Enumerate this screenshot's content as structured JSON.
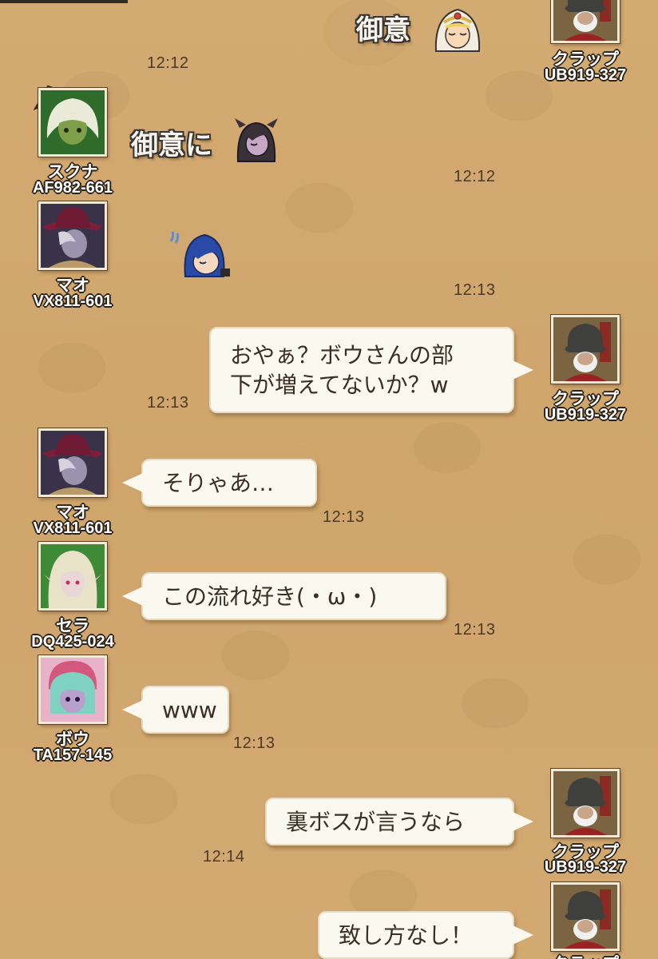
{
  "colors": {
    "background": "#d1a76f",
    "bubble": "#fbf8ef",
    "bubble_text": "#3a2f24",
    "name_outline": "#2b2218",
    "timestamp": "#4a3a26"
  },
  "users": {
    "krapp": {
      "name": "クラップ",
      "id": "UB919-327"
    },
    "sukuna": {
      "name": "スクナ",
      "id": "AF982-661"
    },
    "mao": {
      "name": "マオ",
      "id": "VX811-601"
    },
    "sera": {
      "name": "セラ",
      "id": "DQ425-024"
    },
    "bou": {
      "name": "ボウ",
      "id": "TA157-145"
    }
  },
  "messages": [
    {
      "sender": "クラップ",
      "type": "stamp",
      "stamp_text": "御意",
      "stamp_icon": "priestess-face-icon",
      "time": "12:12"
    },
    {
      "sender": "スクナ",
      "type": "stamp",
      "stamp_text": "御意に",
      "stamp_icon": "dark-elf-face-icon",
      "time": "12:12"
    },
    {
      "sender": "マオ",
      "type": "stamp",
      "stamp_text": "",
      "stamp_icon": "blue-hair-nodding-face-icon",
      "time": "12:13"
    },
    {
      "sender": "クラップ",
      "type": "text",
      "lines": [
        "おやぁ？ボウさんの部",
        "下が増えてないか？w"
      ],
      "time": "12:13"
    },
    {
      "sender": "マオ",
      "type": "text",
      "text": "そりゃあ…",
      "time": "12:13"
    },
    {
      "sender": "セラ",
      "type": "text",
      "text": "この流れ好き(・ω・)",
      "time": "12:13"
    },
    {
      "sender": "ボウ",
      "type": "text",
      "text": "www",
      "time": "12:13"
    },
    {
      "sender": "クラップ",
      "type": "text",
      "text": "裏ボスが言うなら",
      "time": "12:14"
    },
    {
      "sender": "クラップ",
      "type": "text",
      "text": "致し方なし！",
      "time": ""
    }
  ]
}
